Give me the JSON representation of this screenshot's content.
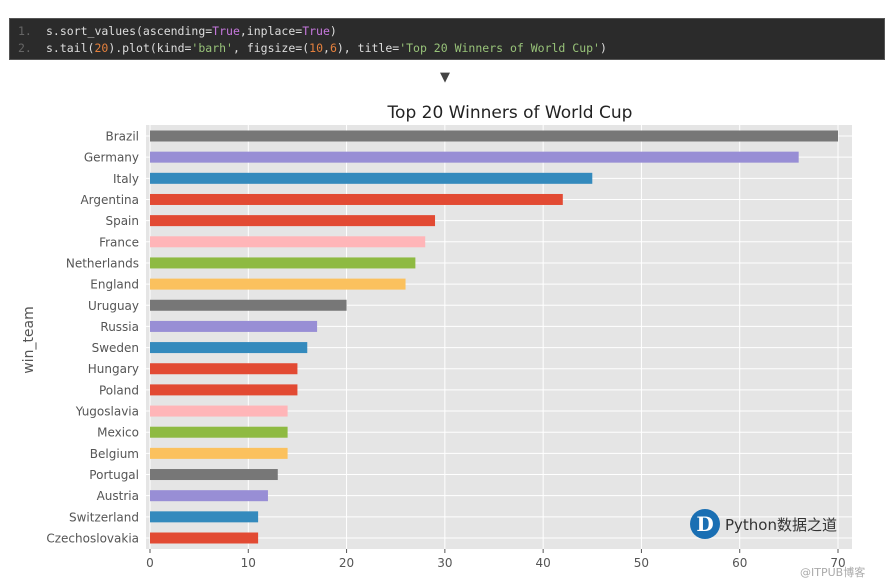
{
  "code": {
    "lines": [
      {
        "num": "1.",
        "parts": [
          {
            "t": "s.sort_values(ascending=",
            "c": ""
          },
          {
            "t": "True",
            "c": "kw"
          },
          {
            "t": ",inplace=",
            "c": ""
          },
          {
            "t": "True",
            "c": "kw"
          },
          {
            "t": ")",
            "c": ""
          }
        ]
      },
      {
        "num": "2.",
        "parts": [
          {
            "t": "s.tail(",
            "c": ""
          },
          {
            "t": "20",
            "c": "num"
          },
          {
            "t": ").plot(kind=",
            "c": ""
          },
          {
            "t": "'barh'",
            "c": "str"
          },
          {
            "t": ", figsize=(",
            "c": ""
          },
          {
            "t": "10",
            "c": "num"
          },
          {
            "t": ",",
            "c": ""
          },
          {
            "t": "6",
            "c": "num"
          },
          {
            "t": "), title=",
            "c": ""
          },
          {
            "t": "'Top 20 Winners of World Cup'",
            "c": "str"
          },
          {
            "t": ")",
            "c": ""
          }
        ]
      }
    ]
  },
  "arrow": "▼",
  "chart_data": {
    "type": "bar",
    "orientation": "horizontal",
    "title": "Top 20 Winners of World Cup",
    "xlabel": "",
    "ylabel": "win_team",
    "categories": [
      "Brazil",
      "Germany",
      "Italy",
      "Argentina",
      "Spain",
      "France",
      "Netherlands",
      "England",
      "Uruguay",
      "Russia",
      "Sweden",
      "Hungary",
      "Poland",
      "Yugoslavia",
      "Mexico",
      "Belgium",
      "Portugal",
      "Austria",
      "Switzerland",
      "Czechoslovakia"
    ],
    "values": [
      70,
      66,
      45,
      42,
      29,
      28,
      27,
      26,
      20,
      17,
      16,
      15,
      15,
      14,
      14,
      14,
      13,
      12,
      11,
      11
    ],
    "colors": [
      "#777777",
      "#988ed5",
      "#348abd",
      "#e24a33",
      "#e24a33",
      "#ffb5b8",
      "#8eba42",
      "#fbc15e",
      "#777777",
      "#988ed5",
      "#348abd",
      "#e24a33",
      "#e24a33",
      "#ffb5b8",
      "#8eba42",
      "#fbc15e",
      "#777777",
      "#988ed5",
      "#348abd",
      "#e24a33"
    ],
    "xlim": [
      0,
      71.5
    ],
    "xticks": [
      0,
      10,
      20,
      30,
      40,
      50,
      60,
      70
    ],
    "grid": true,
    "background": "#e5e5e5"
  },
  "watermark": {
    "logo_letter": "D",
    "text": "Python数据之道"
  },
  "credit": "@ITPUB博客"
}
